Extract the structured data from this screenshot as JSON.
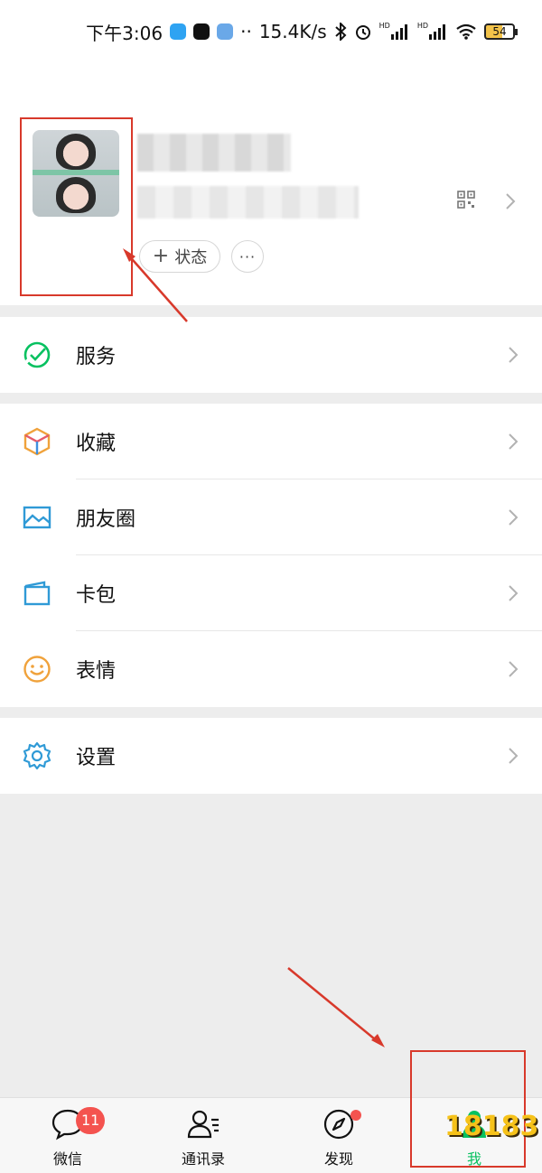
{
  "status_bar": {
    "time": "下午3:06",
    "more": "··",
    "speed": "15.4K/s",
    "battery": "54",
    "hd1": "HD",
    "hd2": "HD"
  },
  "profile": {
    "status_button": "状态",
    "more_button": "···"
  },
  "menu": {
    "service": "服务",
    "favorites": "收藏",
    "moments": "朋友圈",
    "cards": "卡包",
    "stickers": "表情",
    "settings": "设置"
  },
  "tabbar": {
    "chats": "微信",
    "chats_badge": "11",
    "contacts": "通讯录",
    "discover": "发现",
    "me": "我"
  },
  "watermark": "18183",
  "colors": {
    "green": "#07c160",
    "red_annotation": "#d8392b",
    "badge_red": "#f4534f",
    "brand_yellow": "#f6c21a"
  }
}
